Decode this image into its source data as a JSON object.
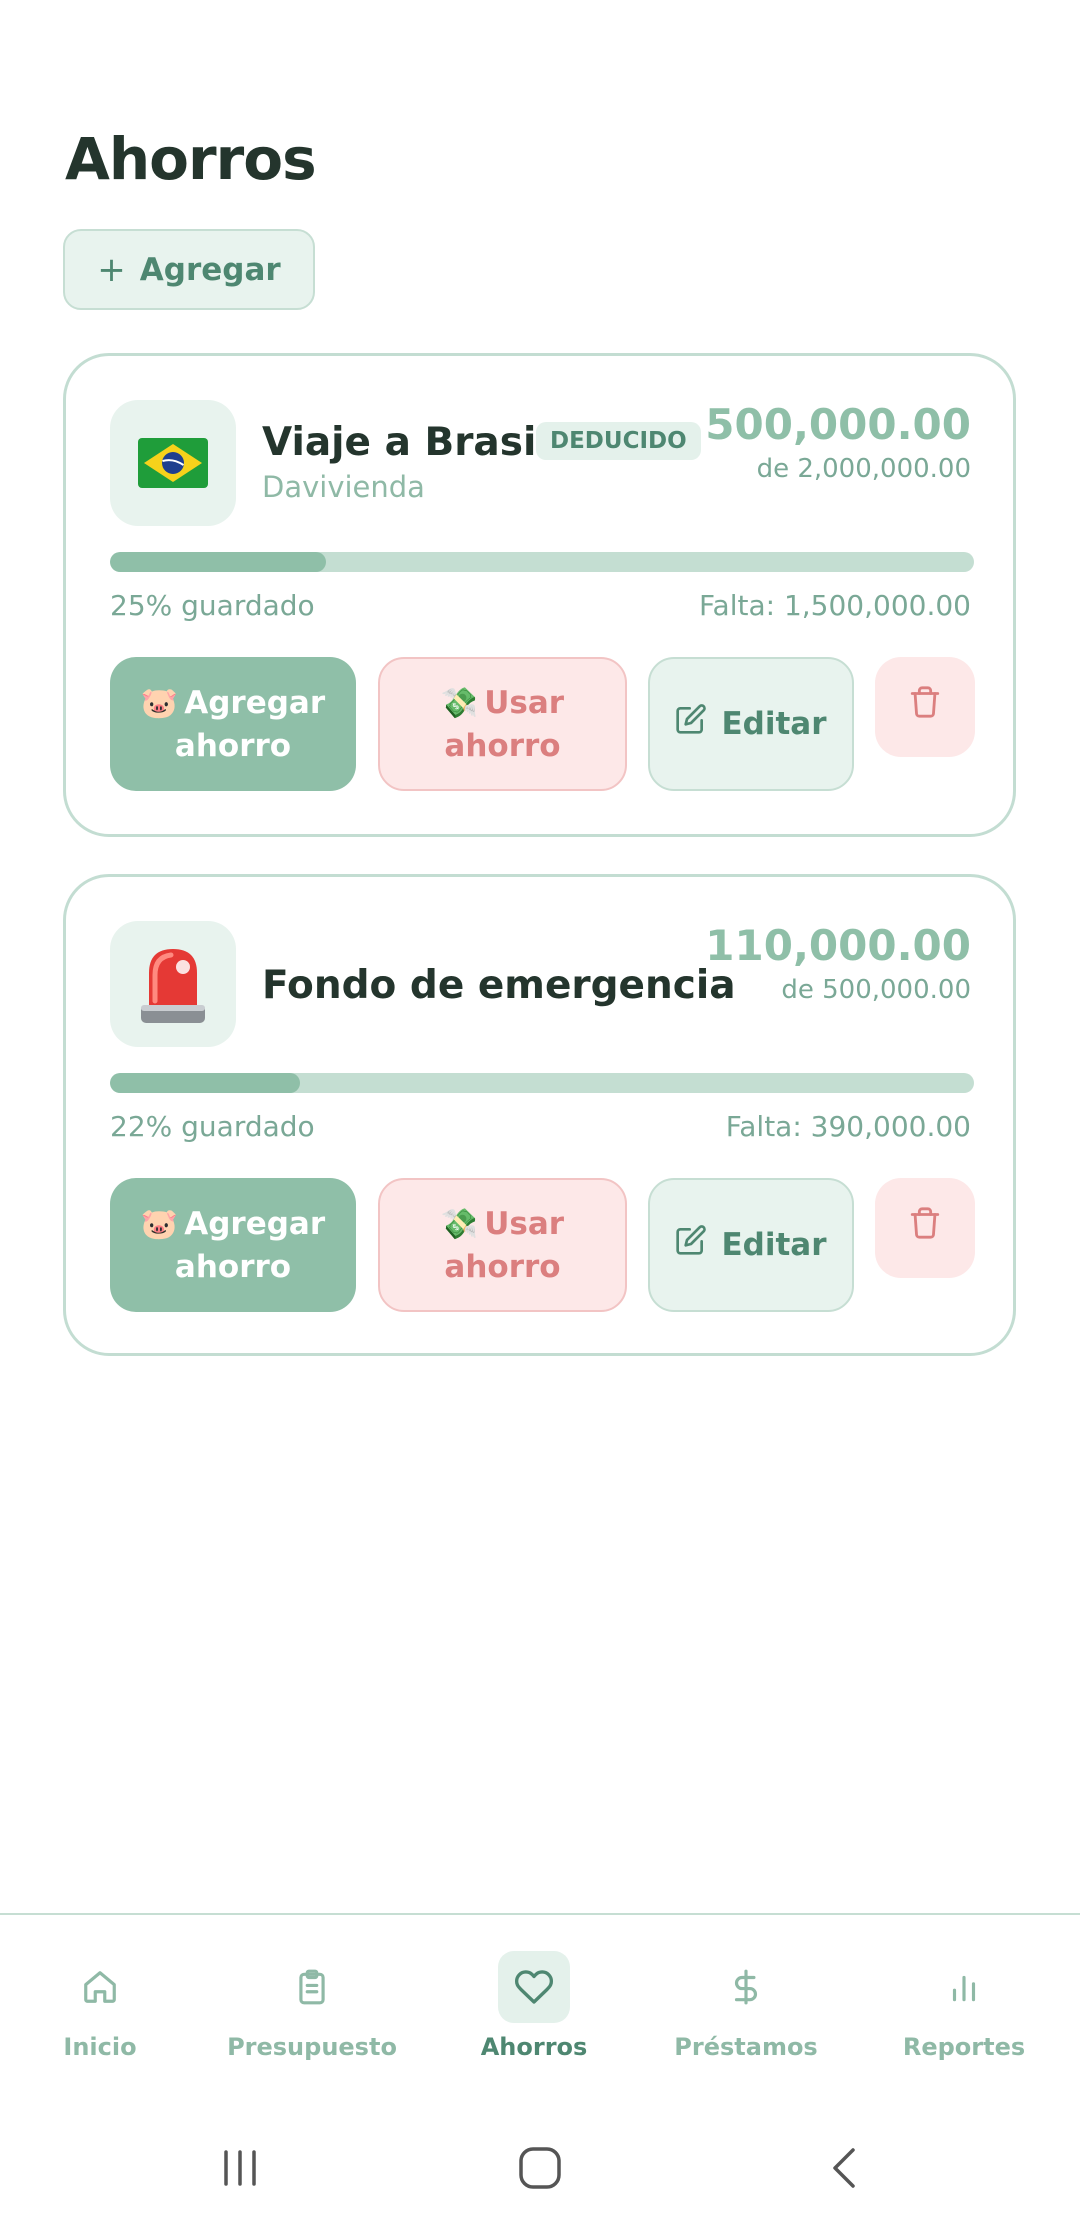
{
  "header": {
    "title": "Ahorros",
    "add_label": "Agregar",
    "add_icon": "plus-icon"
  },
  "savings": [
    {
      "name": "Viaje a Brasil",
      "badge": "DEDUCIDO",
      "bank": "Davivienda",
      "icon": "brazil-flag-icon",
      "amount": "500,000.00",
      "goal": "de 2,000,000.00",
      "progress_percent": 25,
      "saved_label": "25% guardado",
      "remaining_label": "Falta: 1,500,000.00",
      "add_saving_label": "Agregar ahorro",
      "use_saving_label": "Usar ahorro",
      "edit_label": "Editar"
    },
    {
      "name": "Fondo de emergencia",
      "icon": "siren-icon",
      "amount": "110,000.00",
      "goal": "de 500,000.00",
      "progress_percent": 22,
      "saved_label": "22% guardado",
      "remaining_label": "Falta: 390,000.00",
      "add_saving_label": "Agregar ahorro",
      "use_saving_label": "Usar ahorro",
      "edit_label": "Editar"
    }
  ],
  "nav": {
    "items": [
      {
        "label": "Inicio",
        "icon": "home-icon",
        "active": false
      },
      {
        "label": "Presupuesto",
        "icon": "clipboard-icon",
        "active": false
      },
      {
        "label": "Ahorros",
        "icon": "heart-icon",
        "active": true
      },
      {
        "label": "Préstamos",
        "icon": "dollar-icon",
        "active": false
      },
      {
        "label": "Reportes",
        "icon": "bar-chart-icon",
        "active": false
      }
    ]
  },
  "colors": {
    "accent": "#8fbfa8",
    "accent_dark": "#4e8771",
    "danger": "#db7f7f",
    "danger_bg": "#fde8e8",
    "text": "#24352d"
  }
}
